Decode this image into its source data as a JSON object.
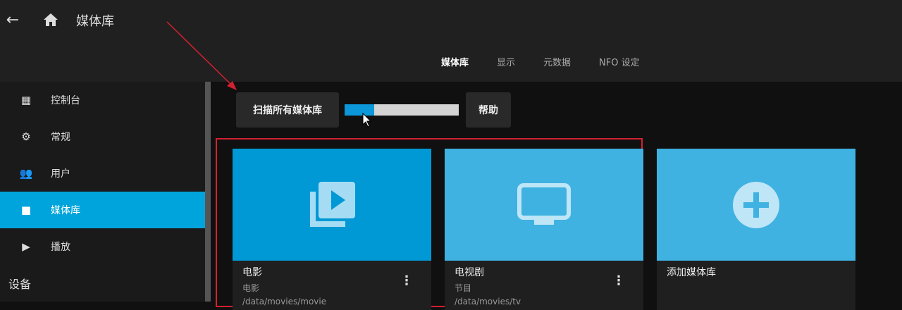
{
  "header": {
    "title": "媒体库",
    "back_icon": "arrow-left-icon",
    "home_icon": "home-icon"
  },
  "tabs": [
    "媒体库",
    "显示",
    "元数据",
    "NFO 设定"
  ],
  "sidebar": {
    "items": [
      {
        "label": "控制台",
        "icon": "dashboard-icon"
      },
      {
        "label": "常规",
        "icon": "gear-icon"
      },
      {
        "label": "用户",
        "icon": "users-icon"
      },
      {
        "label": "媒体库",
        "icon": "folder-icon"
      },
      {
        "label": "播放",
        "icon": "play-icon"
      }
    ],
    "section": "设备"
  },
  "toolbar": {
    "scan_label": "扫描所有媒体库",
    "help_label": "帮助",
    "scan_progress_percent": 26
  },
  "libraries": [
    {
      "title": "电影",
      "type": "电影",
      "path": "/data/movies/movie",
      "color": "#0099d5"
    },
    {
      "title": "电视剧",
      "type": "节目",
      "path": "/data/movies/tv",
      "color": "#3fb2e2"
    }
  ],
  "add_library": {
    "label": "添加媒体库",
    "color": "#3fb2e2"
  }
}
